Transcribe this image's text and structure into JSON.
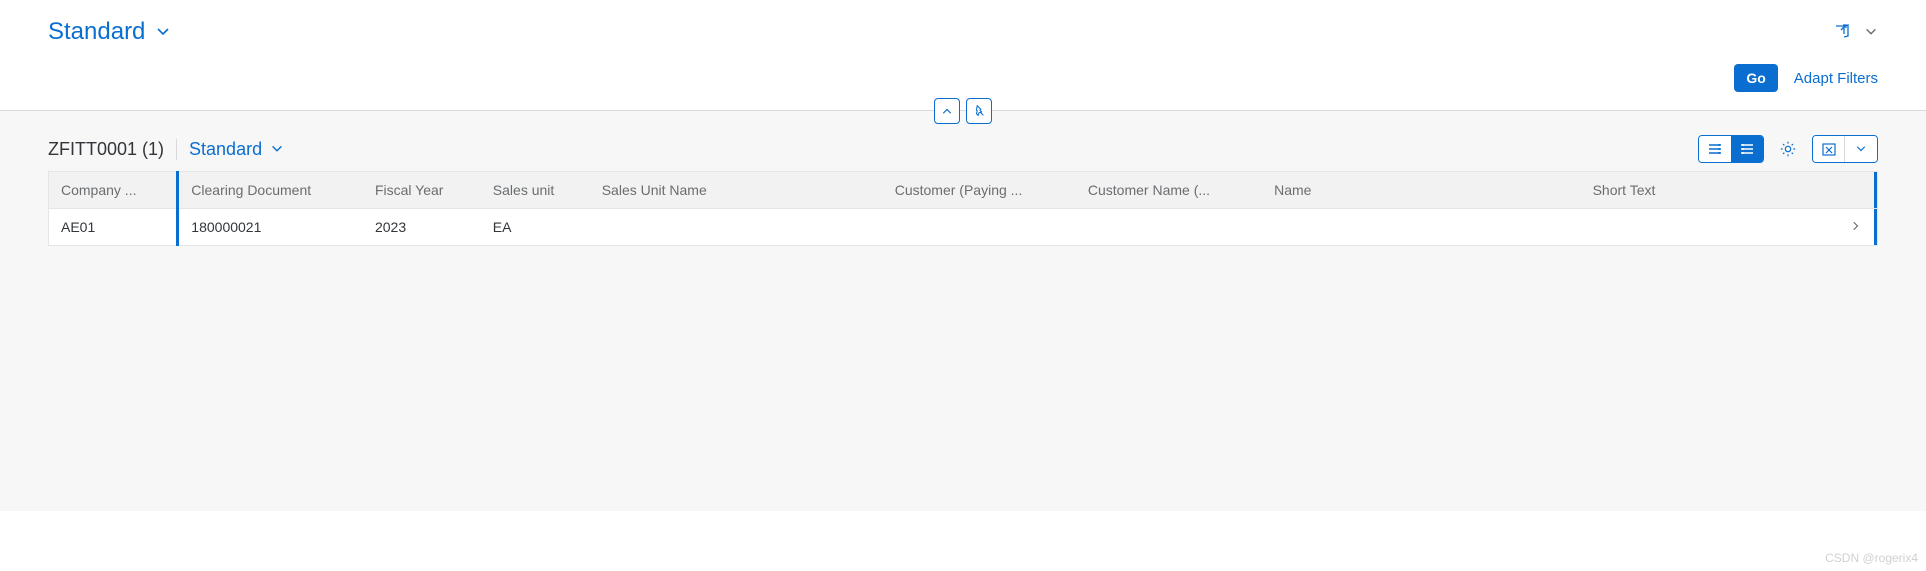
{
  "header": {
    "variant_label": "Standard"
  },
  "filter_bar": {
    "go_label": "Go",
    "adapt_filters_label": "Adapt Filters"
  },
  "table": {
    "title": "ZFITT0001 (1)",
    "variant_label": "Standard",
    "columns": {
      "company": "Company ...",
      "clearing_document": "Clearing Document",
      "fiscal_year": "Fiscal Year",
      "sales_unit": "Sales unit",
      "sales_unit_name": "Sales Unit Name",
      "customer_paying": "Customer (Paying ...",
      "customer_name": "Customer Name (...",
      "name": "Name",
      "short_text": "Short Text"
    },
    "rows": [
      {
        "company": "AE01",
        "clearing_document": "180000021",
        "fiscal_year": "2023",
        "sales_unit": "EA",
        "sales_unit_name": "",
        "customer_paying": "",
        "customer_name": "",
        "name": "",
        "short_text": ""
      }
    ]
  },
  "watermark": "CSDN @rogerix4"
}
